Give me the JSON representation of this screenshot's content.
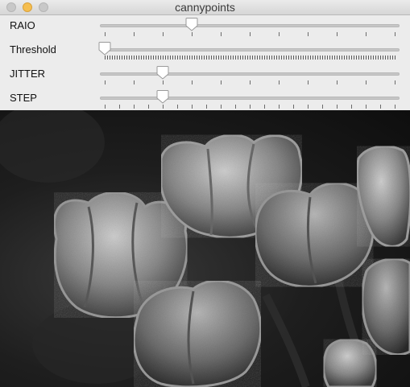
{
  "window": {
    "title": "cannypoints"
  },
  "sliders": [
    {
      "label": "RAIO",
      "value_fraction": 0.3,
      "tick_style": "sparse"
    },
    {
      "label": "Threshold",
      "value_fraction": 0.0,
      "tick_style": "dense"
    },
    {
      "label": "JITTER",
      "value_fraction": 0.2,
      "tick_style": "sparse"
    },
    {
      "label": "STEP",
      "value_fraction": 0.2,
      "tick_style": "sparse"
    }
  ],
  "image": {
    "subject": "grayscale tulips rendered with canny edge points"
  }
}
